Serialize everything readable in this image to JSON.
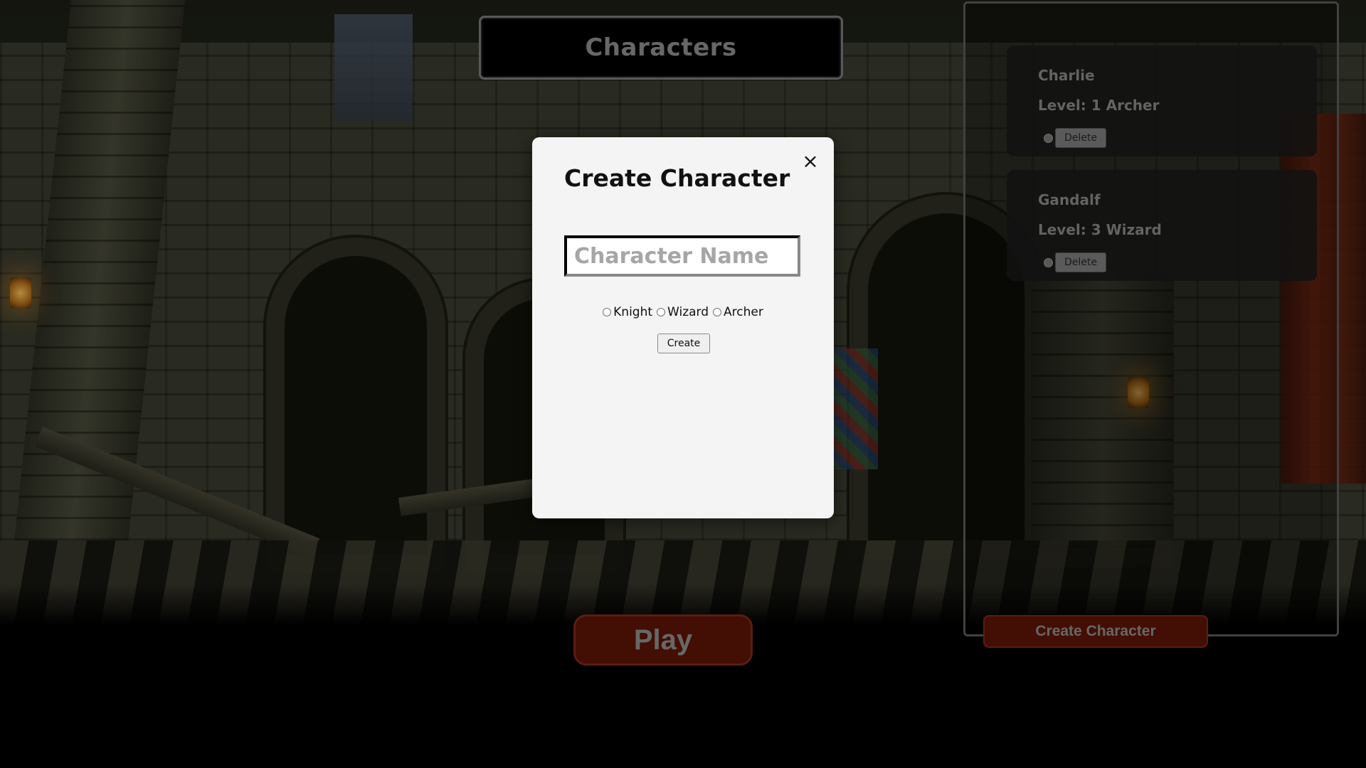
{
  "header": {
    "title": "Characters"
  },
  "characters": [
    {
      "name": "Charlie",
      "level_text": "Level: 1 Archer",
      "delete_label": "Delete"
    },
    {
      "name": "Gandalf",
      "level_text": "Level: 3 Wizard",
      "delete_label": "Delete"
    }
  ],
  "buttons": {
    "play_label": "Play",
    "create_character_label": "Create Character"
  },
  "modal": {
    "title": "Create Character",
    "close_icon": "×",
    "name_placeholder": "Character Name",
    "name_value": "",
    "class_options": [
      {
        "label": "Knight",
        "selected": false
      },
      {
        "label": "Wizard",
        "selected": false
      },
      {
        "label": "Archer",
        "selected": false
      }
    ],
    "create_label": "Create"
  },
  "colors": {
    "accent_button": "#5e1405",
    "modal_bg": "#f4f4f4",
    "muted_text": "#8f8f8f"
  }
}
